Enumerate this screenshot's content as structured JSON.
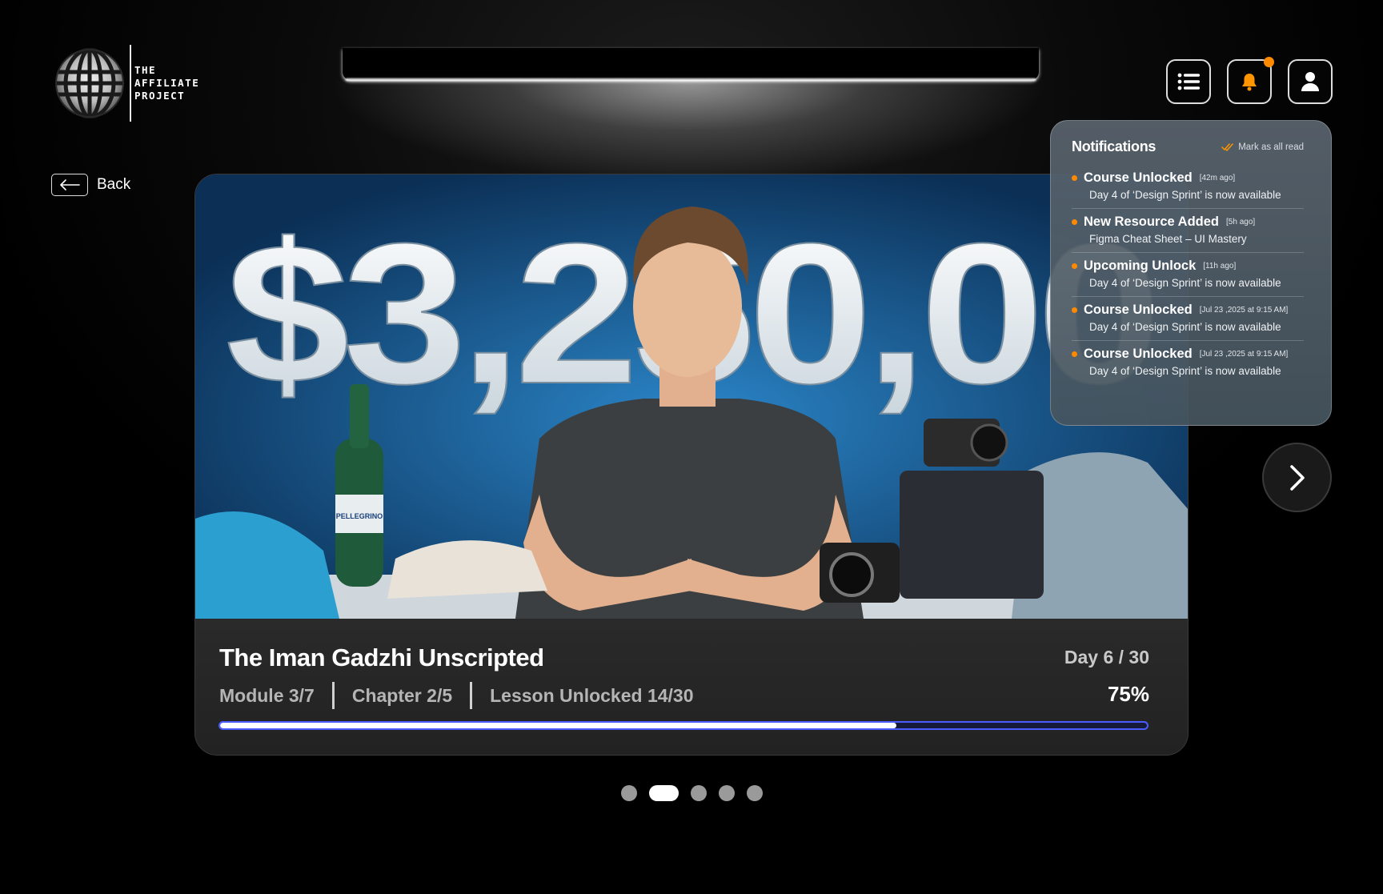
{
  "brand": {
    "line1": "THE",
    "line2": "AFFILIATE",
    "line3": "PROJECT"
  },
  "nav": {
    "back_label": "Back"
  },
  "header": {
    "menu_icon": "list-icon",
    "bell_icon": "bell-icon",
    "profile_icon": "user-icon",
    "has_unread": true
  },
  "notifications": {
    "title": "Notifications",
    "mark_all_label": "Mark as all read",
    "items": [
      {
        "title": "Course Unlocked",
        "time": "[42m ago]",
        "desc": "Day 4 of ‘Design Sprint’ is now available"
      },
      {
        "title": "New Resource Added",
        "time": "[5h ago]",
        "desc": "Figma Cheat Sheet – UI Mastery"
      },
      {
        "title": "Upcoming Unlock",
        "time": "[11h ago]",
        "desc": "Day 4 of ‘Design Sprint’ is now available"
      },
      {
        "title": "Course Unlocked",
        "time": "[Jul 23 ,2025 at 9:15 AM]",
        "desc": "Day 4 of ‘Design Sprint’ is now available"
      },
      {
        "title": "Course Unlocked",
        "time": "[Jul 23 ,2025 at 9:15 AM]",
        "desc": "Day 4 of ‘Design Sprint’ is now available"
      }
    ]
  },
  "course": {
    "thumbnail_text": "$3,250,00",
    "bottle_label": "PELLEGRINO",
    "title": "The Iman Gadzhi Unscripted",
    "day": "Day 6 / 30",
    "module": "Module 3/7",
    "chapter": "Chapter 2/5",
    "lesson": "Lesson Unlocked 14/30",
    "percent_label": "75%",
    "progress": 0.73
  },
  "carousel": {
    "count": 5,
    "active_index": 1
  },
  "colors": {
    "accent_orange": "#ff8a00",
    "progress_border": "#4a5cff"
  }
}
